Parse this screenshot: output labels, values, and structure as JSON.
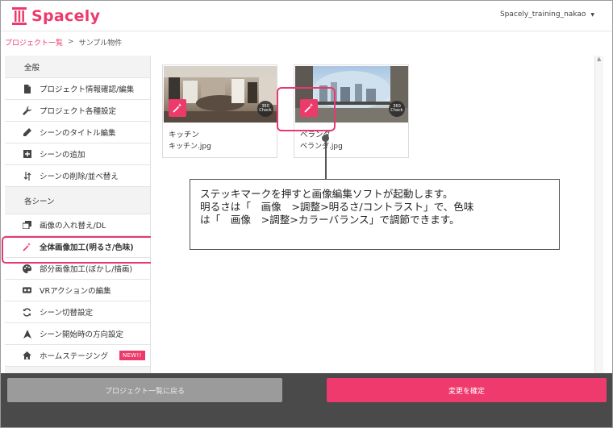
{
  "header": {
    "logo_text": "Spacely",
    "user_name": "Spacely_training_nakao",
    "user_caret": "▼"
  },
  "breadcrumb": {
    "parent": "プロジェクト一覧",
    "separator": ">",
    "current": "サンプル物件"
  },
  "sidebar": {
    "section_general": "全般",
    "general_items": [
      {
        "label": "プロジェクト情報確認/編集",
        "icon": "document-icon"
      },
      {
        "label": "プロジェクト各種設定",
        "icon": "wrench-icon"
      },
      {
        "label": "シーンのタイトル編集",
        "icon": "pencil-icon"
      },
      {
        "label": "シーンの追加",
        "icon": "plus-square-icon"
      },
      {
        "label": "シーンの削除/並べ替え",
        "icon": "sort-arrows-icon"
      }
    ],
    "section_scenes": "各シーン",
    "scene_items": [
      {
        "label": "画像の入れ替え/DL",
        "icon": "image-swap-icon"
      },
      {
        "label": "全体画像加工(明るさ/色味)",
        "icon": "magic-wand-icon",
        "active": true
      },
      {
        "label": "部分画像加工(ぼかし/描画)",
        "icon": "palette-icon"
      },
      {
        "label": "VRアクションの編集",
        "icon": "vr-goggles-icon"
      },
      {
        "label": "シーン切替設定",
        "icon": "refresh-icon"
      },
      {
        "label": "シーン開始時の方向設定",
        "icon": "direction-arrow-icon"
      },
      {
        "label": "ホームステージング",
        "icon": "home-icon",
        "badge": "NEW!!"
      }
    ]
  },
  "scenes": [
    {
      "name": "キッチン",
      "file": "キッチン.jpg",
      "check_top": "360",
      "check_bottom": "Check"
    },
    {
      "name": "ベランダ",
      "file": "ベランダ.jpg",
      "check_top": "360",
      "check_bottom": "Check"
    }
  ],
  "callout": {
    "line1": "ステッキマークを押すと画像編集ソフトが起動します。",
    "line2": "明るさは「　画像　>調整>明るさ/コントラスト」で、色味",
    "line3": "は「　画像　>調整>カラーバランス」で調節できます。"
  },
  "footer": {
    "back_label": "プロジェクト一覧に戻る",
    "confirm_label": "変更を確定"
  },
  "colors": {
    "accent": "#ec3a6b",
    "footer_bg": "#4a4a4a",
    "back_button": "#9b9b9b"
  }
}
